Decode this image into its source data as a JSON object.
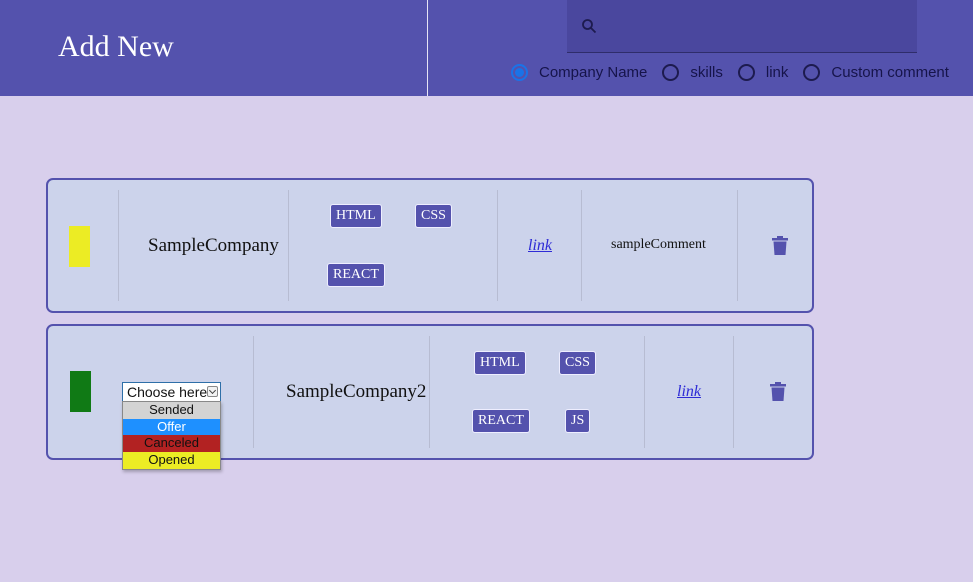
{
  "header": {
    "add_new": "Add New",
    "search": {
      "value": "",
      "icon": "search-icon"
    },
    "radios": [
      {
        "label": "Company Name",
        "checked": true
      },
      {
        "label": "skills",
        "checked": false
      },
      {
        "label": "link",
        "checked": false
      },
      {
        "label": "Custom comment",
        "checked": false
      }
    ]
  },
  "cards": [
    {
      "status_color": "#ecec24",
      "company": "SampleCompany",
      "skills": [
        "HTML",
        "CSS",
        "REACT"
      ],
      "link": "link",
      "comment": "sampleComment"
    },
    {
      "status_color": "#107a15",
      "select": {
        "value": "Choose here",
        "options": [
          {
            "label": "Sended",
            "bg": "#d3d3d3",
            "fg": "#111111"
          },
          {
            "label": "Offer",
            "bg": "#1e90ff",
            "fg": "#ffffff"
          },
          {
            "label": "Canceled",
            "bg": "#b22222",
            "fg": "#111111"
          },
          {
            "label": "Opened",
            "bg": "#ecec24",
            "fg": "#111111"
          }
        ]
      },
      "company": "SampleCompany2",
      "skills": [
        "HTML",
        "CSS",
        "REACT",
        "JS"
      ],
      "link": "link"
    }
  ],
  "colors": {
    "header_bg": "#5452ad",
    "page_bg": "#d8cfec",
    "card_bg": "#ccd3eb",
    "accent": "#5452ad",
    "radio_selected": "#1a73e8"
  }
}
